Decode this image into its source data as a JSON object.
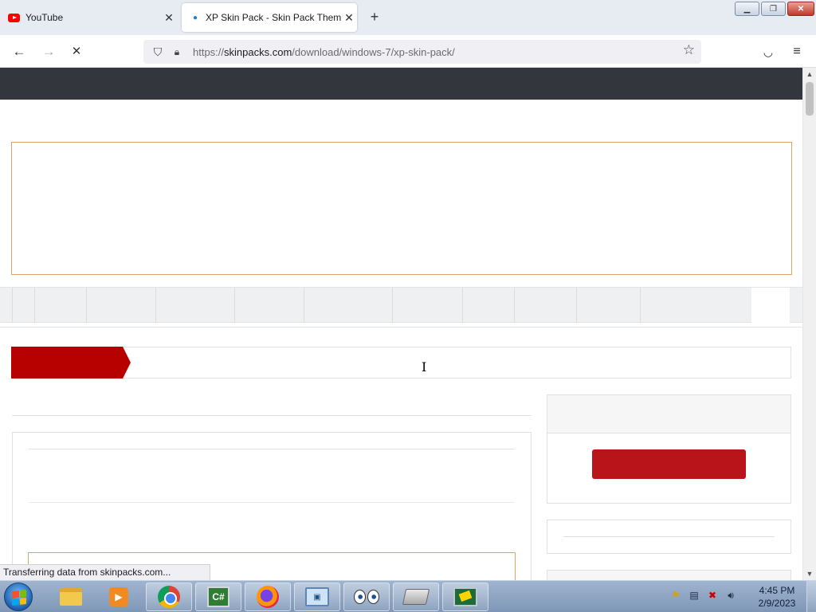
{
  "browser": {
    "tabs": [
      {
        "title": "YouTube",
        "icon": "youtube-icon",
        "active": false
      },
      {
        "title": "XP Skin Pack - Skin Pack Theme",
        "icon": "skinpack-icon",
        "active": true
      }
    ],
    "new_tab_icon": "plus-icon",
    "window_controls": [
      "minimize-icon",
      "restore-icon",
      "close-icon"
    ],
    "url_prefix": "https://",
    "url_host": "skinpacks.com",
    "url_path": "/download/windows-7/xp-skin-pack/",
    "status_text": "Transferring data from skinpacks.com..."
  },
  "page": {
    "header_color": "#33373d",
    "accent_red": "#b70000",
    "button_red": "#b81419",
    "ad_border": "#d9a867"
  },
  "taskbar": {
    "apps": [
      "windows-explorer-icon",
      "media-player-icon",
      "chrome-icon",
      "csharp-icon",
      "firefox-icon",
      "control-panel-icon",
      "eyes-icon",
      "drive-icon",
      "remote-desktop-icon"
    ],
    "csharp_label": "C#",
    "clock_time": "4:45 PM",
    "clock_date": "2/9/2023"
  }
}
